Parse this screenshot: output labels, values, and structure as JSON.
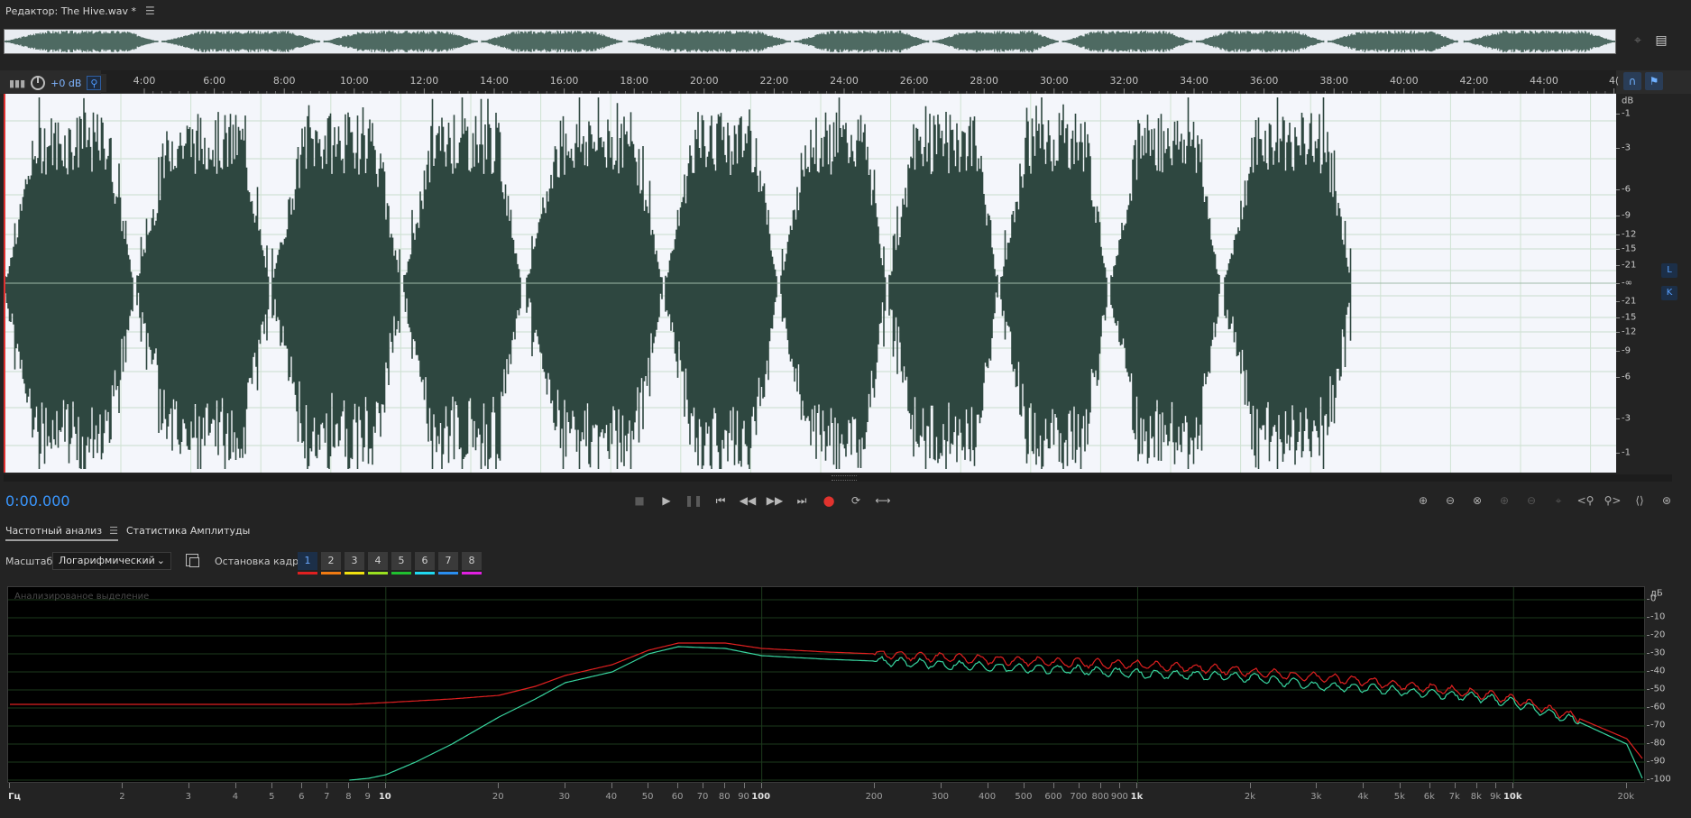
{
  "editor": {
    "title": "Редактор: The Hive.wav *"
  },
  "hud": {
    "volume": "+0 dB"
  },
  "ruler": {
    "labels": [
      "4:00",
      "6:00",
      "8:00",
      "10:00",
      "12:00",
      "14:00",
      "16:00",
      "18:00",
      "20:00",
      "22:00",
      "24:00",
      "26:00",
      "28:00",
      "30:00",
      "32:00",
      "34:00",
      "36:00",
      "38:00",
      "40:00",
      "42:00",
      "44:00",
      "4("
    ]
  },
  "db_scale": {
    "unit": "dB",
    "labels": [
      "-1",
      "-3",
      "-6",
      "-9",
      "-12",
      "-15",
      "-21",
      "-∞",
      "-21",
      "-15",
      "-12",
      "-9",
      "-6",
      "-3",
      "-1"
    ]
  },
  "channels": [
    "L",
    "K"
  ],
  "transport": {
    "time": "0:00.000"
  },
  "panel": {
    "tabs": [
      {
        "label": "Частотный анализ"
      },
      {
        "label": "Статистика Амплитуды"
      }
    ],
    "scale_label": "Масштаб:",
    "scale_value": "Логарифмический",
    "freeze_label": "Остановка кадра:",
    "frames": [
      {
        "label": "1",
        "color": "#e02020"
      },
      {
        "label": "2",
        "color": "#f07a12"
      },
      {
        "label": "3",
        "color": "#f0e010"
      },
      {
        "label": "4",
        "color": "#9ae020"
      },
      {
        "label": "5",
        "color": "#20c030"
      },
      {
        "label": "6",
        "color": "#20d8f0"
      },
      {
        "label": "7",
        "color": "#2a8ef0"
      },
      {
        "label": "8",
        "color": "#e020e0"
      }
    ]
  },
  "spectrum": {
    "caption": "Анализированое выделение",
    "db_unit": "дБ",
    "db_labels": [
      "0",
      "-10",
      "-20",
      "-30",
      "-40",
      "-50",
      "-60",
      "-70",
      "-80",
      "-90",
      "-100"
    ],
    "freq_labels": [
      "Гц",
      "2",
      "3",
      "4",
      "5",
      "6",
      "7",
      "8",
      "9",
      "10",
      "20",
      "30",
      "40",
      "50",
      "60",
      "70",
      "80",
      "90",
      "100",
      "200",
      "300",
      "400",
      "500",
      "600",
      "700",
      "800",
      "900",
      "1k",
      "2k",
      "3k",
      "4k",
      "5k",
      "6k",
      "7k",
      "8k",
      "9k",
      "10k",
      "20k"
    ],
    "colors": {
      "red": "#e02020",
      "green": "#38d6a0"
    }
  },
  "chart_data": {
    "type": "line",
    "xlabel": "Гц",
    "ylabel": "дБ",
    "x_scale": "log",
    "xlim": [
      1,
      22000
    ],
    "ylim": [
      -100,
      0
    ],
    "series": [
      {
        "color": "#e02020",
        "x": [
          1,
          2,
          5,
          8,
          10,
          15,
          20,
          25,
          30,
          40,
          50,
          60,
          80,
          100,
          150,
          200,
          300,
          500,
          700,
          1000,
          1500,
          2000,
          3000,
          4000,
          6000,
          8000,
          10000,
          12000,
          15000,
          20000,
          22000
        ],
        "y": [
          -58,
          -58,
          -58,
          -58,
          -57,
          -55,
          -53,
          -48,
          -42,
          -36,
          -28,
          -24,
          -24,
          -27,
          -29,
          -30,
          -32,
          -34,
          -35,
          -36,
          -38,
          -40,
          -43,
          -45,
          -49,
          -52,
          -55,
          -60,
          -66,
          -77,
          -88
        ]
      },
      {
        "color": "#38d6a0",
        "x": [
          8,
          9,
          10,
          12,
          15,
          20,
          25,
          30,
          40,
          50,
          60,
          80,
          100,
          150,
          200,
          300,
          500,
          700,
          1000,
          1500,
          2000,
          3000,
          4000,
          6000,
          8000,
          10000,
          12000,
          15000,
          20000,
          22000
        ],
        "y": [
          -100,
          -99,
          -97,
          -90,
          -80,
          -65,
          -55,
          -46,
          -40,
          -30,
          -26,
          -27,
          -31,
          -33,
          -34,
          -36,
          -38,
          -39,
          -41,
          -42,
          -43,
          -48,
          -49,
          -52,
          -54,
          -57,
          -62,
          -68,
          -80,
          -99
        ]
      }
    ]
  }
}
